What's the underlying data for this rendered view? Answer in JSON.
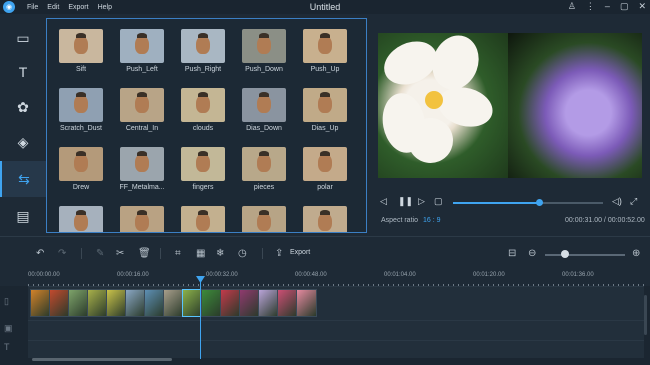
{
  "window": {
    "title": "Untitled",
    "menu": [
      "File",
      "Edit",
      "Export",
      "Help"
    ],
    "controls": [
      "person-icon",
      "more-icon",
      "minimize-icon",
      "maximize-icon",
      "close-icon"
    ]
  },
  "rail": {
    "items": [
      {
        "icon": "media-icon",
        "glyph": "▭"
      },
      {
        "icon": "text-icon",
        "glyph": "T"
      },
      {
        "icon": "filter-icon",
        "glyph": "✿"
      },
      {
        "icon": "overlay-icon",
        "glyph": "◈"
      },
      {
        "icon": "transition-icon",
        "glyph": "⇆"
      },
      {
        "icon": "film-icon",
        "glyph": "▤"
      }
    ]
  },
  "transitions": [
    {
      "label": "Sift",
      "bg": "#c9b79e"
    },
    {
      "label": "Push_Left",
      "bg": "#9fb0c0"
    },
    {
      "label": "Push_Right",
      "bg": "#a9b7c3"
    },
    {
      "label": "Push_Down",
      "bg": "#8b8f86"
    },
    {
      "label": "Push_Up",
      "bg": "#c8b08e"
    },
    {
      "label": "Scratch_Dust",
      "bg": "#8fa0b2"
    },
    {
      "label": "Central_In",
      "bg": "#b8a487"
    },
    {
      "label": "clouds",
      "bg": "#c4b694"
    },
    {
      "label": "Dias_Down",
      "bg": "#8a94a0"
    },
    {
      "label": "Dias_Up",
      "bg": "#c0aa88"
    },
    {
      "label": "Drew",
      "bg": "#b49a7a"
    },
    {
      "label": "FF_Metalma...",
      "bg": "#9ba5ad"
    },
    {
      "label": "fingers",
      "bg": "#c2b898"
    },
    {
      "label": "pieces",
      "bg": "#b8a88a"
    },
    {
      "label": "polar",
      "bg": "#c4aa8a"
    },
    {
      "label": "",
      "bg": "#a6b1bd"
    },
    {
      "label": "",
      "bg": "#b9a283"
    },
    {
      "label": "",
      "bg": "#c3b08f"
    },
    {
      "label": "",
      "bg": "#b7a486"
    },
    {
      "label": "",
      "bg": "#c0ab8e"
    }
  ],
  "player": {
    "progress": 0.57,
    "aspect_label": "Aspect ratio",
    "aspect_value": "16 : 9",
    "timecode": "00:00:31.00 / 00:00:52.00",
    "buttons": [
      "prev-icon",
      "pause-icon",
      "next-icon",
      "stop-icon",
      "volume-icon",
      "fullscreen-icon"
    ]
  },
  "toolbar": {
    "export_label": "Export",
    "zoom_level": 0.25
  },
  "timeline": {
    "ticks": [
      "00:00:00.00",
      "00:00:16.00",
      "00:00:32.00",
      "00:00:48.00",
      "00:01:04.00",
      "00:01:20.00",
      "00:01:36.00"
    ],
    "clips": [
      "#d1822a",
      "#c24a2e",
      "#7ea36a",
      "#a8b04a",
      "#c9c24a",
      "#8aa7c4",
      "#5d8fb4",
      "#a79e8b",
      "#8bb14a",
      "#3d8b3a",
      "#c33a4b",
      "#8f3a6e",
      "#b9a4d8",
      "#cb4f74",
      "#e58aa0"
    ]
  }
}
